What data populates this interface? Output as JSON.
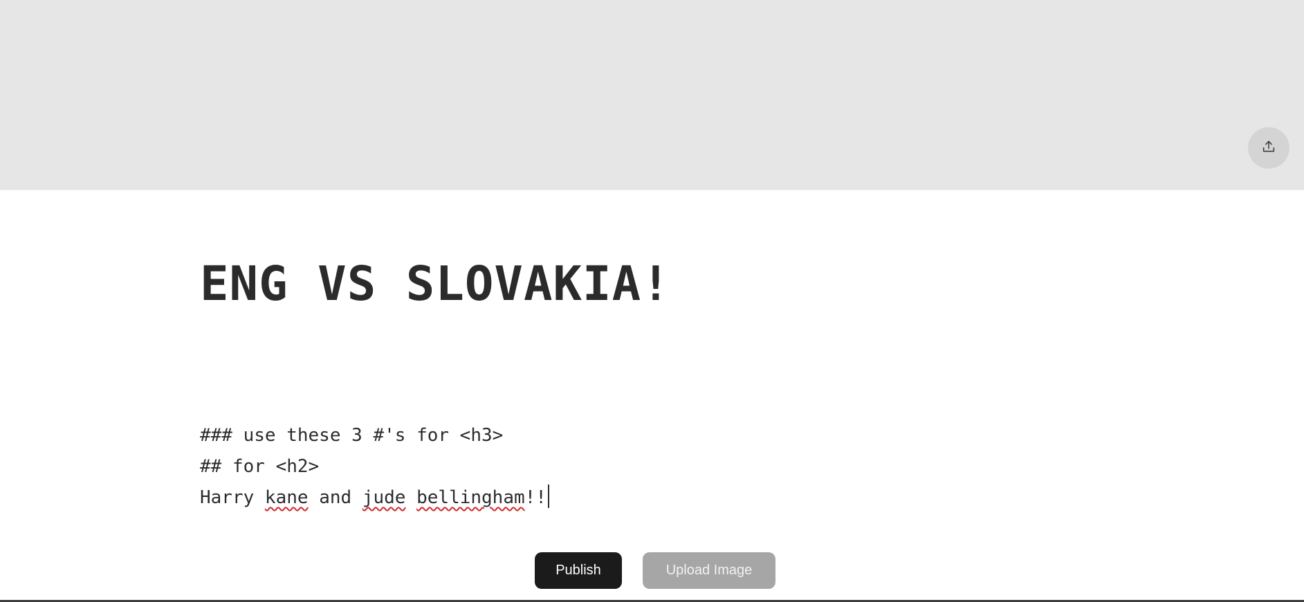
{
  "banner": {
    "color": "#e6e6e6",
    "upload_icon": "upload-icon"
  },
  "post": {
    "title": "ENG VS SLOVAKIA!",
    "lines": [
      {
        "segments": [
          {
            "text": "### use these 3 #'s for <h3>",
            "misspelled": false
          }
        ]
      },
      {
        "segments": [
          {
            "text": "## for <h2>",
            "misspelled": false
          }
        ]
      },
      {
        "segments": [
          {
            "text": "Harry ",
            "misspelled": false
          },
          {
            "text": "kane",
            "misspelled": true
          },
          {
            "text": " and ",
            "misspelled": false
          },
          {
            "text": "jude",
            "misspelled": true
          },
          {
            "text": " ",
            "misspelled": false
          },
          {
            "text": "bellingham",
            "misspelled": true
          },
          {
            "text": "!!",
            "misspelled": false
          }
        ]
      }
    ]
  },
  "actions": {
    "publish_label": "Publish",
    "upload_image_label": "Upload Image"
  },
  "colors": {
    "text": "#2b2b2b",
    "publish_bg": "#1b1b1b",
    "upload_bg": "#a6a6a6",
    "spellcheck": "#d12a2a"
  }
}
